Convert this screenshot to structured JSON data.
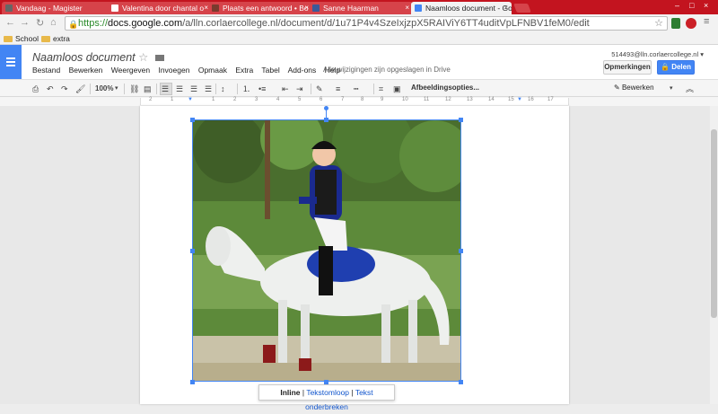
{
  "browser": {
    "tabs": [
      {
        "title": "Vandaag - Magister",
        "favicon_color": "#666666"
      },
      {
        "title": "Valentina door chantal o",
        "favicon_color": "#ffffff"
      },
      {
        "title": "Plaats een antwoord • Bo",
        "favicon_color": "#7a3b2e"
      },
      {
        "title": "Sanne Haarman",
        "favicon_color": "#3b5998"
      },
      {
        "title": "Naamloos document - Go",
        "favicon_color": "#4285f4"
      }
    ],
    "url_proto": "https://",
    "url_host": "docs.google.com",
    "url_path": "/a/lln.corlaercollege.nl/document/d/1u71P4v4SzeIxjzpX5RAIViY6TT4uditVpLFNBV1feM0/edit",
    "bookmarks": [
      "School",
      "extra"
    ]
  },
  "docs": {
    "title": "Naamloos document",
    "menu": [
      "Bestand",
      "Bewerken",
      "Weergeven",
      "Invoegen",
      "Opmaak",
      "Extra",
      "Tabel",
      "Add-ons",
      "Help"
    ],
    "save_status": "Alle wijzigingen zijn opgeslagen in Drive",
    "account": "514493@lln.corlaercollege.nl",
    "comments_button": "Opmerkingen",
    "share_button": "Delen",
    "zoom": "100%",
    "image_options": "Afbeeldingsopties...",
    "mode": "Bewerken"
  },
  "ruler": {
    "labels": [
      "2",
      "1",
      "1",
      "2",
      "3",
      "4",
      "5",
      "6",
      "7",
      "8",
      "9",
      "10",
      "11",
      "12",
      "13",
      "14",
      "15",
      "16",
      "17",
      "18"
    ]
  },
  "wrap": {
    "inline": "Inline",
    "text_flow": "Tekstomloop",
    "break_text": "Tekst onderbreken"
  },
  "icons": {
    "print": "print-icon",
    "undo": "undo-icon",
    "redo": "redo-icon",
    "paint_format": "paint-format-icon"
  }
}
